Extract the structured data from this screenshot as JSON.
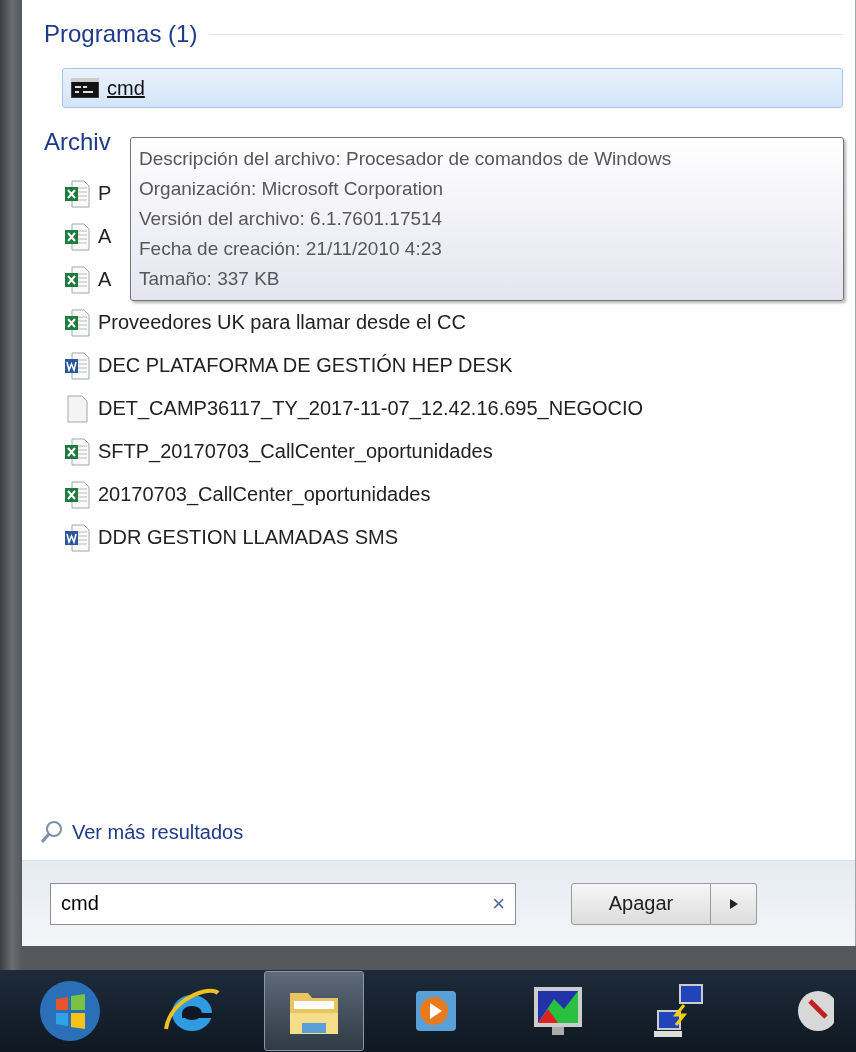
{
  "programs": {
    "heading": "Programas (1)",
    "items": [
      {
        "kind": "console",
        "label": "cmd",
        "selected": true
      }
    ]
  },
  "files": {
    "heading": "Archiv",
    "items": [
      {
        "kind": "excel",
        "label": "P"
      },
      {
        "kind": "excel",
        "label": "A"
      },
      {
        "kind": "excel",
        "label": "A"
      },
      {
        "kind": "excel",
        "label": "Proveedores UK para llamar desde el CC"
      },
      {
        "kind": "word",
        "label": "DEC PLATAFORMA DE GESTIÓN HEP DESK"
      },
      {
        "kind": "text",
        "label": "DET_CAMP36117_TY_2017-11-07_12.42.16.695_NEGOCIO"
      },
      {
        "kind": "excel",
        "label": "SFTP_20170703_CallCenter_oportunidades"
      },
      {
        "kind": "excel",
        "label": "20170703_CallCenter_oportunidades"
      },
      {
        "kind": "word",
        "label": "DDR GESTION LLAMADAS SMS"
      }
    ]
  },
  "tooltip": {
    "lines": [
      "Descripción del archivo: Procesador de comandos de Windows",
      "Organización: Microsoft Corporation",
      "Versión del archivo: 6.1.7601.17514",
      "Fecha de creación: 21/11/2010 4:23",
      "Tamaño: 337 KB"
    ]
  },
  "more_results": "Ver más resultados",
  "search": {
    "value": "cmd",
    "clear": "×"
  },
  "shutdown": {
    "label": "Apagar"
  },
  "taskbar": [
    {
      "kind": "start",
      "selected": false
    },
    {
      "kind": "browser",
      "selected": false
    },
    {
      "kind": "folder",
      "selected": true
    },
    {
      "kind": "media",
      "selected": false
    },
    {
      "kind": "monitor",
      "selected": false
    },
    {
      "kind": "network",
      "selected": false
    },
    {
      "kind": "tool",
      "selected": false
    }
  ]
}
